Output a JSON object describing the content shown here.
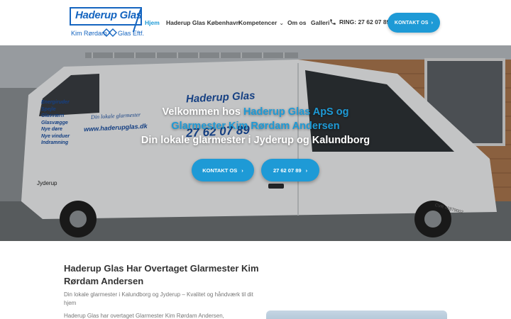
{
  "header": {
    "logo": {
      "title": "Haderup Glas",
      "sub_left": "Kim Rørdam",
      "sub_right": "Glas Eftf."
    },
    "nav": [
      {
        "label": "Hjem",
        "active": true
      },
      {
        "label": "Haderup Glas København",
        "active": false
      },
      {
        "label": "Kompetencer",
        "active": false,
        "has_dropdown": true
      },
      {
        "label": "Om os",
        "active": false
      },
      {
        "label": "Galleri",
        "active": false
      }
    ],
    "phone_label": "RING: 27 62 07 89",
    "cta_label": "KONTAKT OS",
    "cta_arrow": "›"
  },
  "hero": {
    "line1_prefix": "Velkommen hos ",
    "line1_highlight": "Haderup Glas ApS og",
    "line2_highlight": "Glarmester Kim Rørdam Andersen",
    "line3": "Din lokale glarmester i Jyderup og Kalundborg",
    "buttons": [
      {
        "label": "KONTAKT OS",
        "arrow": "›"
      },
      {
        "label": "27 62 07 89",
        "arrow": "›"
      }
    ],
    "van_text": {
      "list": [
        "Energiruder",
        "Spejle",
        "Glasværn",
        "Glasvægge",
        "Nye døre",
        "Nye vinduer",
        "Indramning"
      ],
      "tagline": "Din lokale glarmester",
      "website": "www.haderupglas.dk",
      "brand": "Haderup Glas",
      "phone": "27 62 07 89",
      "plate_city": "Jyderup",
      "cvr": "CVR 42879002"
    }
  },
  "content": {
    "title": "Haderup Glas Har Overtaget Glarmester Kim Rørdam Andersen",
    "subtitle": "Din lokale glarmester i Kalundborg og Jyderup – Kvalitet og håndværk til dit hjem",
    "body_start": "Haderup Glas har overtaget Glarmester Kim Rørdam Andersen,"
  },
  "colors": {
    "accent": "#1e9ad6",
    "logo_blue": "#1565c0",
    "text_dark": "#333333",
    "text_muted": "#777777"
  },
  "icons": {
    "phone": "phone-icon",
    "chevron": "chevron-down-icon",
    "arrow": "chevron-right-icon"
  }
}
